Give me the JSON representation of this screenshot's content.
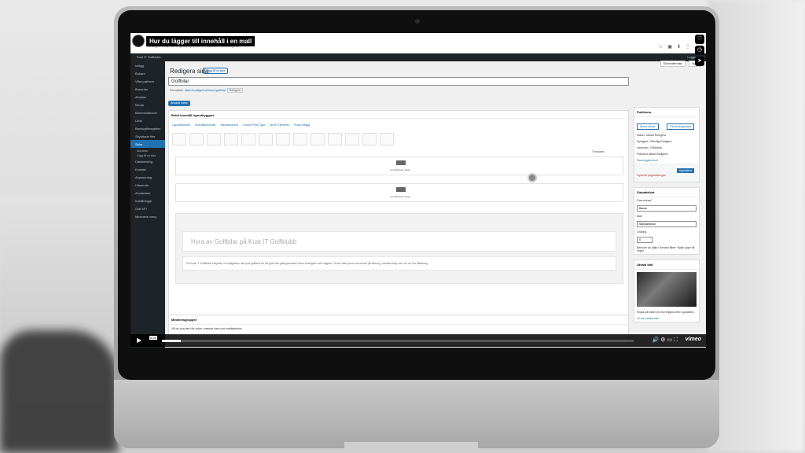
{
  "video": {
    "title": "Hur du lägger till innehåll i en mall",
    "time": "0:01",
    "provider": "vimeo",
    "progress_fraction": 0.04
  },
  "browser": {
    "url": "kustitgolf.se/wp-admin/post.php?post=1770&action=edit&lang=en"
  },
  "adminbar": {
    "site": "Kust IT Golfklubb",
    "right": "Logga ut"
  },
  "sidebar": {
    "items": [
      {
        "label": "Inlägg"
      },
      {
        "label": "Bokare"
      },
      {
        "label": "Våra partners"
      },
      {
        "label": "Banorder"
      },
      {
        "label": "Aktivitet"
      },
      {
        "label": "Media"
      },
      {
        "label": "Banrestriktioner"
      },
      {
        "label": "Länk"
      },
      {
        "label": "Banavgiftsregister"
      },
      {
        "label": "Skyddade filer"
      },
      {
        "label": "Sidor"
      }
    ],
    "sub": [
      "Alla sidor",
      "Lägg till ny sida"
    ],
    "items2": [
      {
        "label": "Databehörig"
      },
      {
        "label": "Kontakt"
      },
      {
        "label": "Anpassning"
      },
      {
        "label": "Utseende"
      },
      {
        "label": "Användare"
      },
      {
        "label": "Inställningar"
      },
      {
        "label": "Golf API"
      },
      {
        "label": "Minimera meny"
      }
    ]
  },
  "page": {
    "heading": "Redigera sida",
    "add_new": "Lägg till ny sida",
    "title_value": "Golfbilar",
    "permalink_label": "Permalänk:",
    "permalink": "https://kustitgolf.se/banor/golfbilar/",
    "permalink_btn": "Redigera",
    "builder_btn": "Använd editor",
    "screen_options": "Skärmalternativ",
    "help": "Hjälp"
  },
  "builder": {
    "title": "Beldt Innehåll layoutbyggare",
    "tabs": [
      "Layoutelement",
      "Innehållsmoduler",
      "Mediaelement",
      "Custom Post Type",
      "WooF Elements",
      "Plugin-tillägg"
    ],
    "row_label": "Innehåll Easy Slider",
    "templates": "Templates",
    "module_heading": "Hyra av Golfbilar på Kust IT Golfklubb",
    "module_text": "På Kust IT Golfklubb erbjuder vi möjligheten att hyra golfbilar för att göra din golfupplevelse ännu smidigare och roligare. Vi har olika priser beroende på säsong, medlemskap och om du har tilläsning."
  },
  "meta": {
    "title": "Medlemsgrupper",
    "text": "Vill du visa den här sidan i menyer bara som medlemsbon"
  },
  "publish": {
    "title": "Publicera",
    "preview_btn": "Spara utkast",
    "changes_btn": "Förhandsgranska",
    "status": "Status: Utkast Redigera",
    "visibility": "Synlighet: Offentlig Redigera",
    "revisions": "Versioner: 3 Bläddra",
    "published": "Publicera direkt Redigera",
    "seo": "Stavningskontroll",
    "trash": "Flytta till papperskorgen",
    "update": "Uppdatera"
  },
  "attributes": {
    "title": "Sidoattribut",
    "parent_label": "Överordnad",
    "parent_value": "Banan",
    "template_label": "Mall",
    "template_value": "Standardmall",
    "order_label": "Ordning",
    "order_value": "0",
    "help_text": "Behöver du hjälp? Använd fliken 'Hjälp' uppe till höger"
  },
  "featured": {
    "title": "Utvald bild",
    "caption": "Klicka på bilden för att redigera eller uppdatera",
    "remove": "Ta bort utvald bild"
  }
}
